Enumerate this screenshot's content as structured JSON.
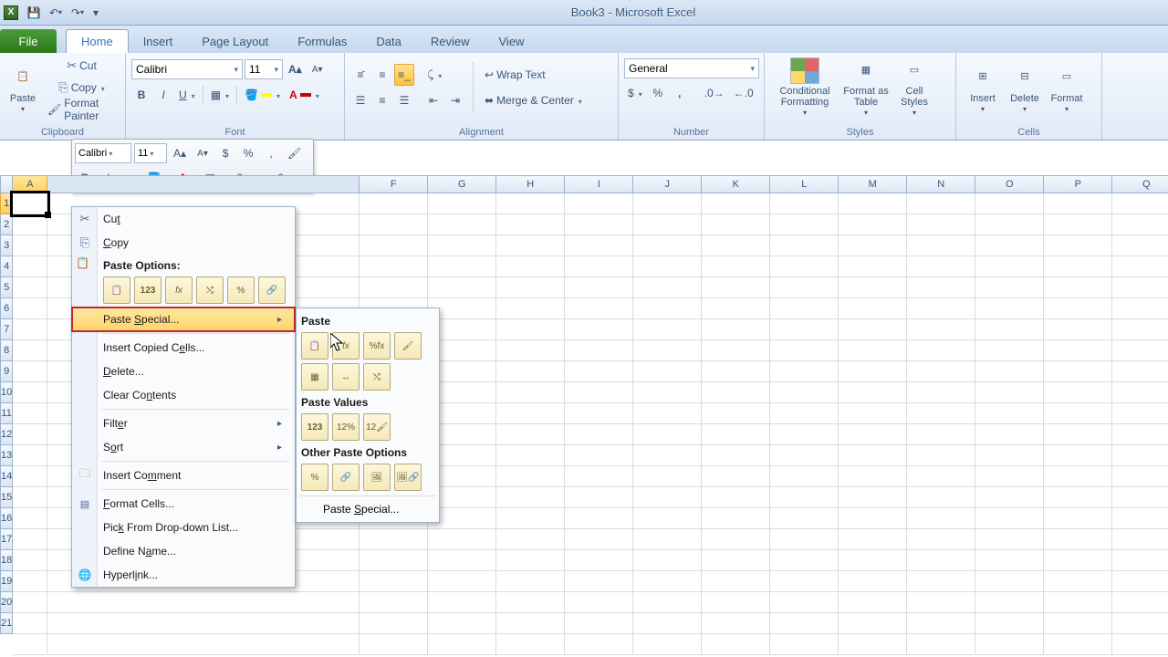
{
  "title": "Book3 - Microsoft Excel",
  "tabs": {
    "file": "File",
    "home": "Home",
    "insert": "Insert",
    "pagelayout": "Page Layout",
    "formulas": "Formulas",
    "data": "Data",
    "review": "Review",
    "view": "View"
  },
  "clipboard": {
    "label": "Clipboard",
    "cut": "Cut",
    "copy": "Copy",
    "formatpainter": "Format Painter",
    "paste": "Paste"
  },
  "font": {
    "label": "Font",
    "name": "Calibri",
    "size": "11"
  },
  "alignment": {
    "label": "Alignment",
    "wraptext": "Wrap Text",
    "merge": "Merge & Center"
  },
  "number": {
    "label": "Number",
    "format": "General"
  },
  "styles": {
    "label": "Styles",
    "cond": "Conditional Formatting",
    "fas": "Format as Table",
    "cell": "Cell Styles"
  },
  "cells": {
    "label": "Cells",
    "insert": "Insert",
    "delete": "Delete",
    "format": "Format"
  },
  "minitoolbar": {
    "font": "Calibri",
    "size": "11"
  },
  "columns": [
    "A",
    "F",
    "G",
    "H",
    "I",
    "J",
    "K",
    "L",
    "M",
    "N",
    "O",
    "P",
    "Q"
  ],
  "rows": [
    "1",
    "2",
    "3",
    "4",
    "5",
    "6",
    "7",
    "8",
    "9",
    "10",
    "11",
    "12",
    "13",
    "14",
    "15",
    "16",
    "17",
    "18",
    "19",
    "20",
    "21"
  ],
  "ctx": {
    "cut": "Cut",
    "copy": "Copy",
    "pasteopts": "Paste Options:",
    "pastespecial": "Paste Special...",
    "insertcopied": "Insert Copied Cells...",
    "delete": "Delete...",
    "clear": "Clear Contents",
    "filter": "Filter",
    "sort": "Sort",
    "insertcomment": "Insert Comment",
    "formatcells": "Format Cells...",
    "pickfrom": "Pick From Drop-down List...",
    "definename": "Define Name...",
    "hyperlink": "Hyperlink..."
  },
  "sub": {
    "paste": "Paste",
    "pastevalues": "Paste Values",
    "other": "Other Paste Options",
    "pastespecial": "Paste Special..."
  },
  "paste_icons": {
    "p1": "📋",
    "p2": "123",
    "p3": "fx",
    "p4": "⤭",
    "p5": "%",
    "p6": "⎘"
  }
}
